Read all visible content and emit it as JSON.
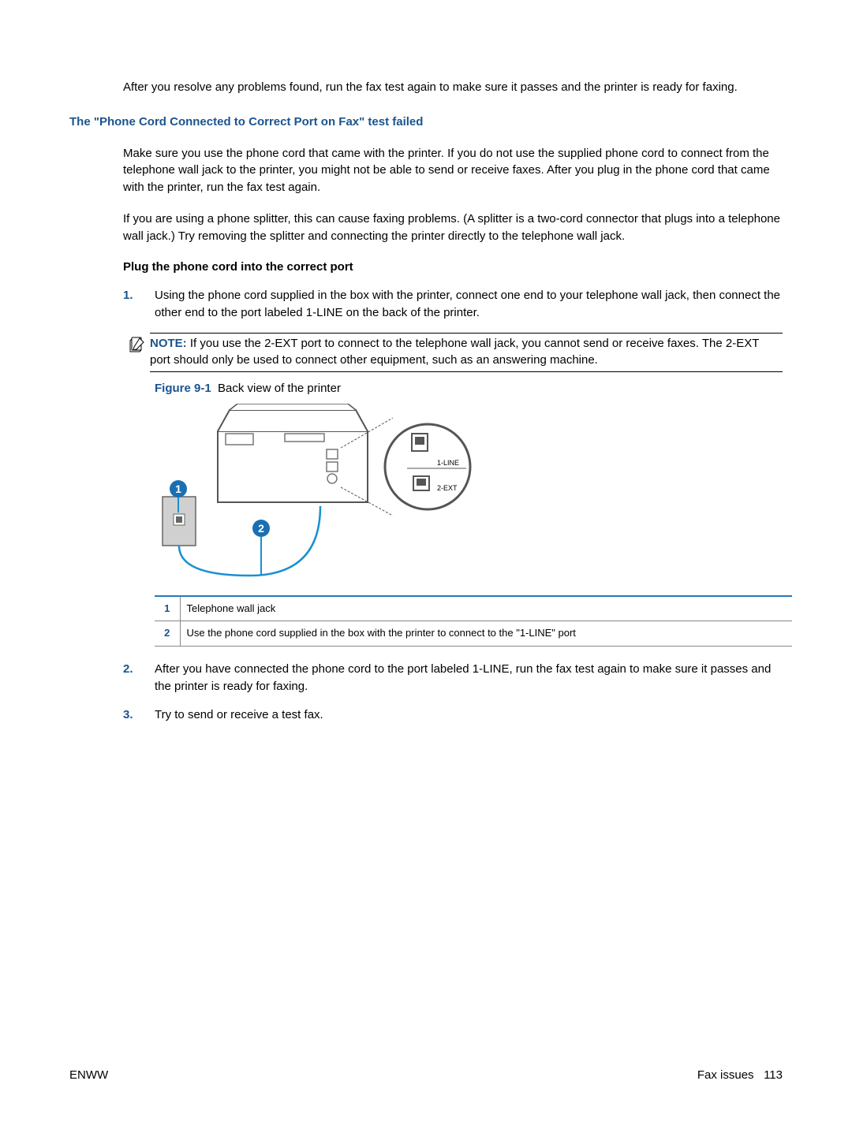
{
  "intro": "After you resolve any problems found, run the fax test again to make sure it passes and the printer is ready for faxing.",
  "section_heading": "The \"Phone Cord Connected to Correct Port on Fax\" test failed",
  "para1": "Make sure you use the phone cord that came with the printer. If you do not use the supplied phone cord to connect from the telephone wall jack to the printer, you might not be able to send or receive faxes. After you plug in the phone cord that came with the printer, run the fax test again.",
  "para2": "If you are using a phone splitter, this can cause faxing problems. (A splitter is a two-cord connector that plugs into a telephone wall jack.) Try removing the splitter and connecting the printer directly to the telephone wall jack.",
  "subheading": "Plug the phone cord into the correct port",
  "steps": {
    "s1": "Using the phone cord supplied in the box with the printer, connect one end to your telephone wall jack, then connect the other end to the port labeled 1-LINE on the back of the printer.",
    "s2": "After you have connected the phone cord to the port labeled 1-LINE, run the fax test again to make sure it passes and the printer is ready for faxing.",
    "s3": "Try to send or receive a test fax."
  },
  "note": {
    "label": "NOTE:",
    "text": "If you use the 2-EXT port to connect to the telephone wall jack, you cannot send or receive faxes. The 2-EXT port should only be used to connect other equipment, such as an answering machine."
  },
  "figure": {
    "label": "Figure 9-1",
    "caption": "Back view of the printer",
    "port1": "1-LINE",
    "port2": "2-EXT",
    "callout1": "1",
    "callout2": "2"
  },
  "legend": {
    "r1num": "1",
    "r1text": "Telephone wall jack",
    "r2num": "2",
    "r2text": "Use the phone cord supplied in the box with the printer to connect to the \"1-LINE\" port"
  },
  "footer": {
    "left": "ENWW",
    "right_label": "Fax issues",
    "right_page": "113"
  }
}
